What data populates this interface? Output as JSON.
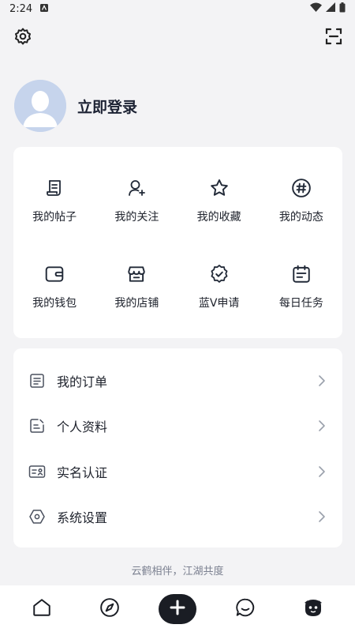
{
  "status_bar": {
    "time": "2:24"
  },
  "profile": {
    "login_label": "立即登录"
  },
  "grid": {
    "row1": [
      {
        "label": "我的帖子",
        "icon": "post-icon"
      },
      {
        "label": "我的关注",
        "icon": "follow-icon"
      },
      {
        "label": "我的收藏",
        "icon": "star-icon"
      },
      {
        "label": "我的动态",
        "icon": "hashtag-icon"
      }
    ],
    "row2": [
      {
        "label": "我的钱包",
        "icon": "wallet-icon"
      },
      {
        "label": "我的店铺",
        "icon": "store-icon"
      },
      {
        "label": "蓝V申请",
        "icon": "verified-badge-icon"
      },
      {
        "label": "每日任务",
        "icon": "calendar-icon"
      }
    ]
  },
  "menu": [
    {
      "label": "我的订单",
      "icon": "order-icon"
    },
    {
      "label": "个人资料",
      "icon": "profile-edit-icon"
    },
    {
      "label": "实名认证",
      "icon": "id-card-icon"
    },
    {
      "label": "系统设置",
      "icon": "hex-settings-icon"
    }
  ],
  "slogan": "云鹤相伴，江湖共度",
  "bottom_nav": [
    "home-icon",
    "compass-icon",
    "add-icon",
    "chat-icon",
    "mascot-icon"
  ]
}
